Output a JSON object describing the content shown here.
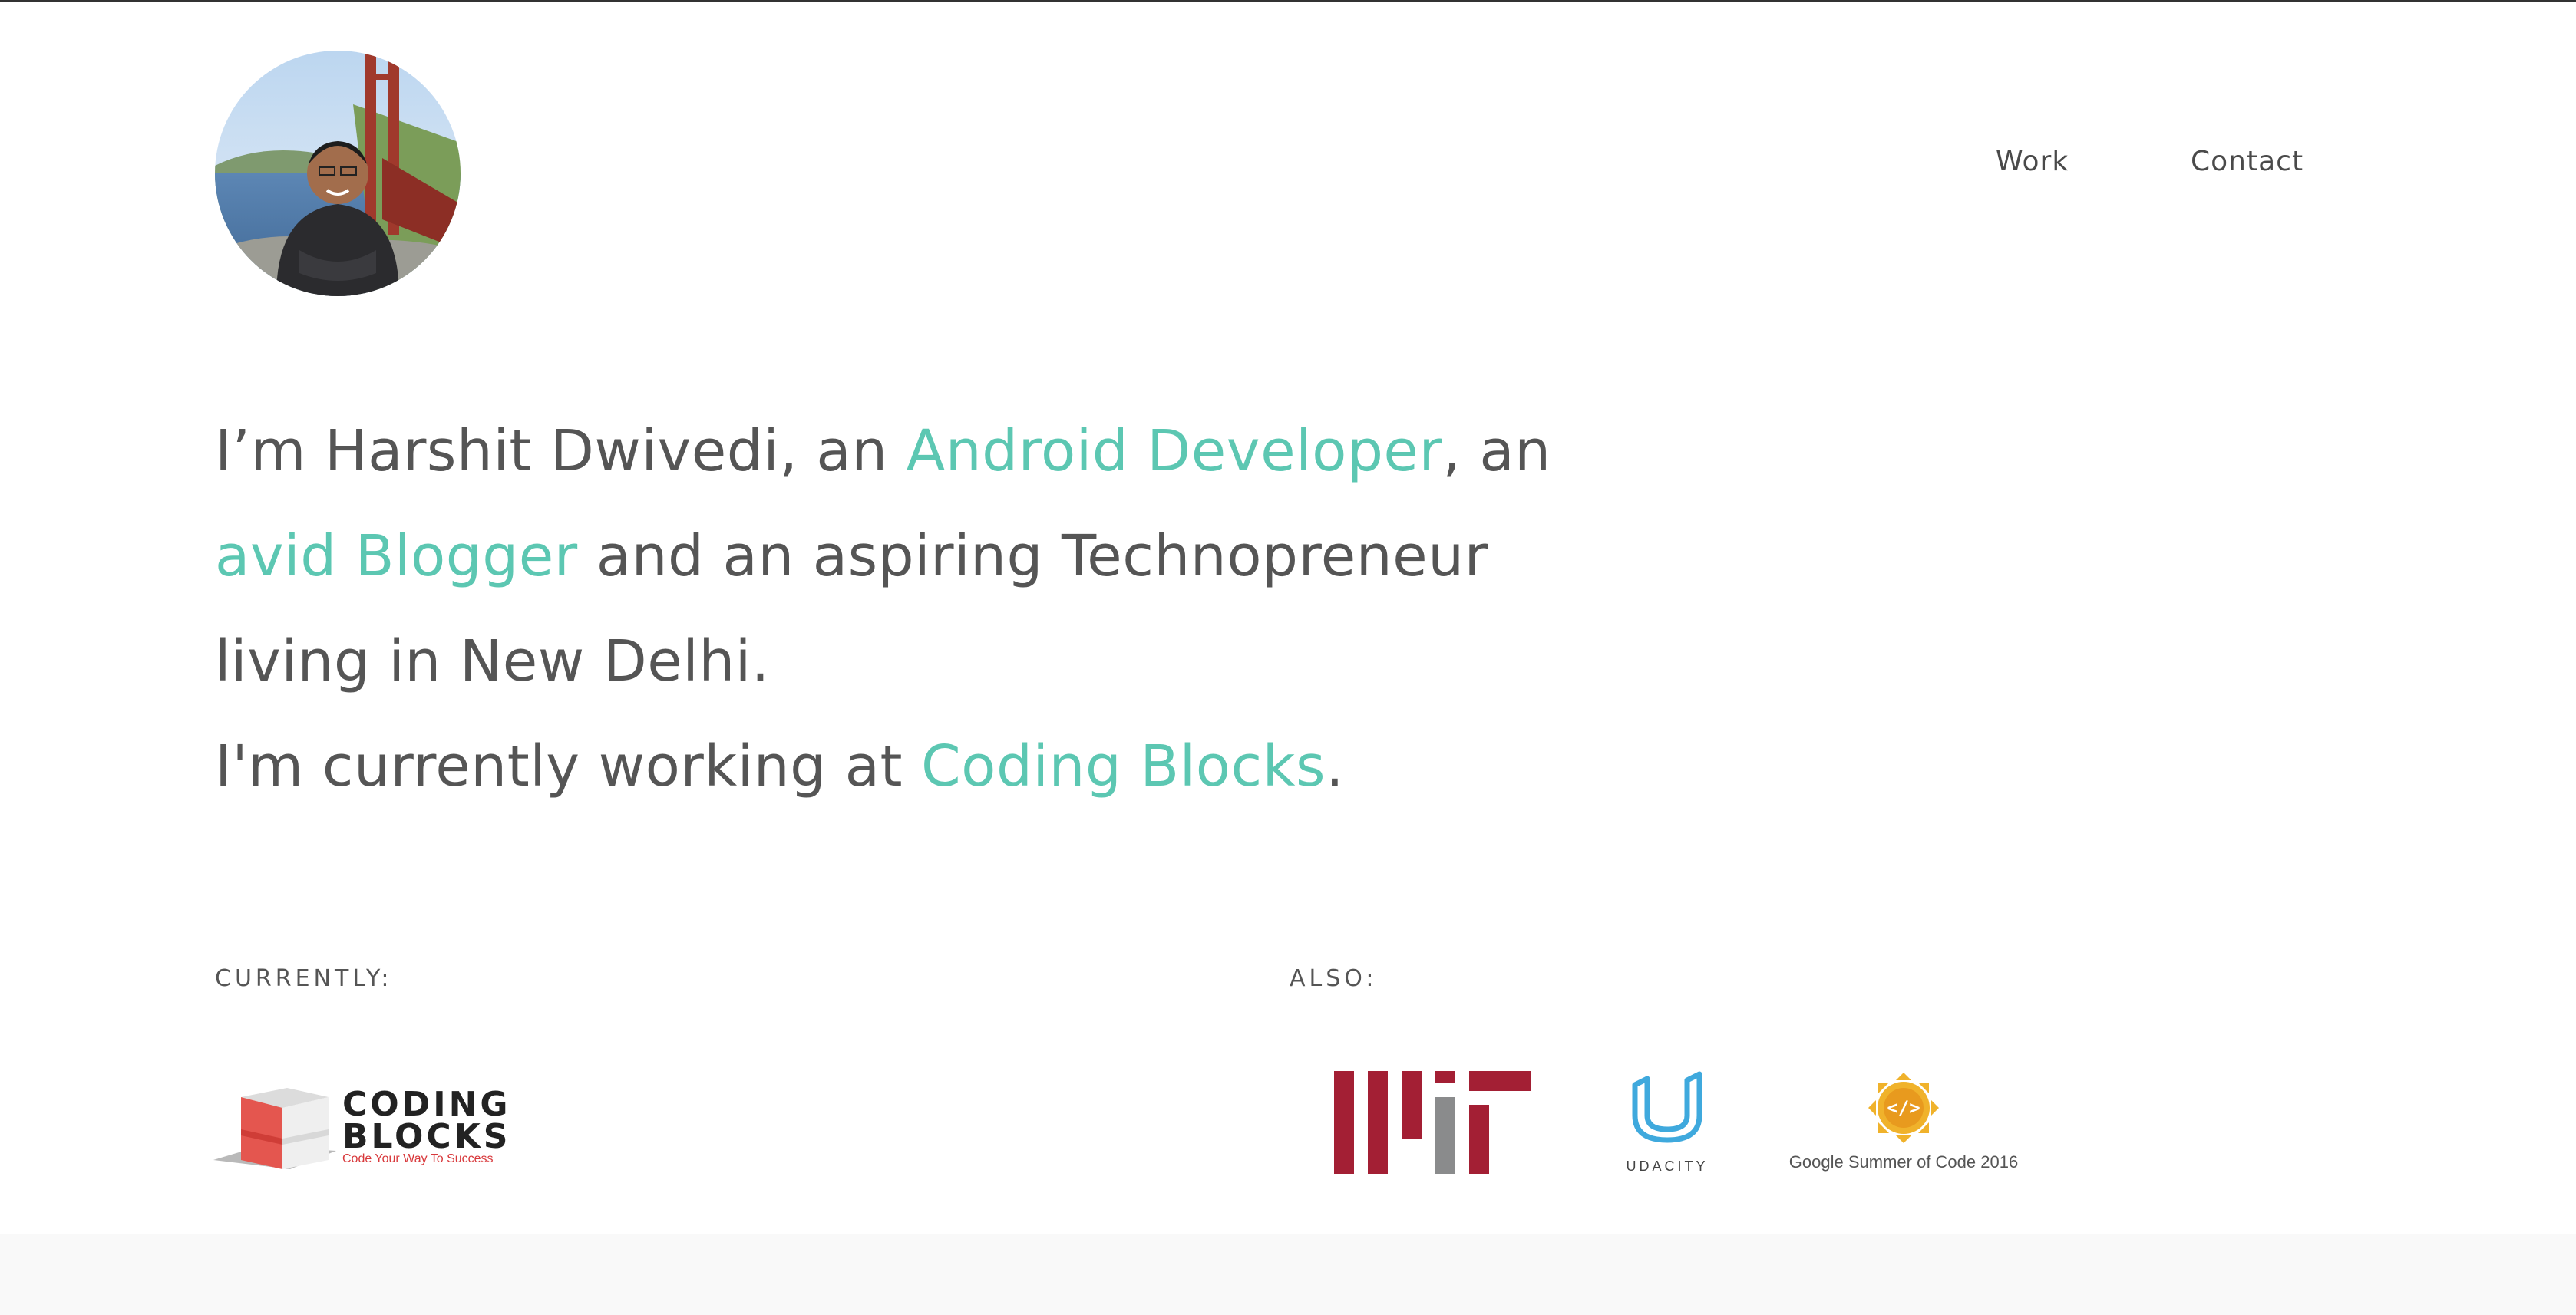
{
  "header": {
    "avatar_alt": "Harshit Dwivedi",
    "nav": {
      "work": "Work",
      "contact": "Contact"
    }
  },
  "intro": {
    "p1_a": "I’m Harshit Dwivedi, an ",
    "p1_hl1": "Android Developer",
    "p1_b": ", an",
    "p2_hl2": "avid Blogger",
    "p2_c": " and an aspiring Technopreneur",
    "p3": "living in New Delhi.",
    "p4_a": "I'm currently working at ",
    "p4_hl3": "Coding Blocks",
    "p4_b": "."
  },
  "sections": {
    "currently_label": "CURRENTLY:",
    "also_label": "ALSO:"
  },
  "logos": {
    "coding_blocks": {
      "line1": "CODING",
      "line2": "BLOCKS",
      "tagline": "Code Your Way To Success"
    },
    "mit": {
      "name": "MIT"
    },
    "udacity": {
      "word": "UDACITY"
    },
    "gsoc": {
      "caption": "Google Summer of Code 2016"
    }
  },
  "colors": {
    "accent": "#5cc7b2",
    "text": "#555555",
    "mit_red": "#a31f34",
    "mit_gray": "#8a8b8c",
    "udacity_blue": "#3fa9dd",
    "gsoc_yellow": "#f0b22b",
    "cb_red": "#e4564f"
  }
}
